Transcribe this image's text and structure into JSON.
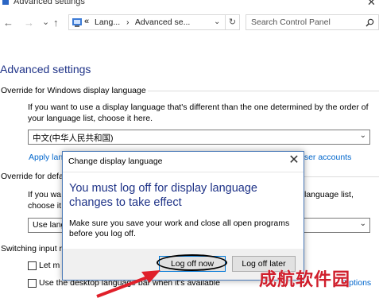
{
  "window": {
    "title": "Advanced settings"
  },
  "nav": {
    "back_glyph": "←",
    "forward_glyph": "→",
    "dropdown_glyph": "⌄",
    "up_glyph": "↑"
  },
  "address": {
    "lead": "«",
    "crumbs": [
      "Lang...",
      "Advanced se..."
    ],
    "separator": "›"
  },
  "search": {
    "placeholder": "Search Control Panel"
  },
  "page": {
    "heading": "Advanced settings"
  },
  "override_display": {
    "header": "Override for Windows display language",
    "description": "If you want to use a display language that's different than the one determined by the order of your language list, choose it here.",
    "selected": "中文(中华人民共和国)",
    "link_left": "Apply lan",
    "link_right": "user accounts"
  },
  "override_default": {
    "header": "Override for defa",
    "desc_left_1": "If you wa",
    "desc_left_2": "choose it",
    "desc_right": "language list,",
    "selected_partial": "Use lang"
  },
  "switching": {
    "header": "Switching input r",
    "item1_label": "Let m",
    "item2_label": "Use the desktop language bar when it's available",
    "item2_link": "Options"
  },
  "dialog": {
    "title": "Change display language",
    "headline": "You must log off for display language changes to take effect",
    "body": "Make sure you save your work and close all open programs before you log off.",
    "primary_button": "Log off now",
    "secondary_button": "Log off later"
  },
  "watermark": "成航软件园",
  "colors": {
    "heading_blue": "#1e3287",
    "link_blue": "#0066cc",
    "arrow_red": "#e0202a",
    "watermark_red": "#d01f2c",
    "focus_border": "#0078d7"
  },
  "icons": [
    "window-icon",
    "back-arrow-icon",
    "forward-arrow-icon",
    "recent-dropdown-icon",
    "up-arrow-icon",
    "control-panel-icon",
    "refresh-icon",
    "search-icon",
    "chevron-down-icon",
    "close-icon",
    "red-pointer-arrow"
  ]
}
